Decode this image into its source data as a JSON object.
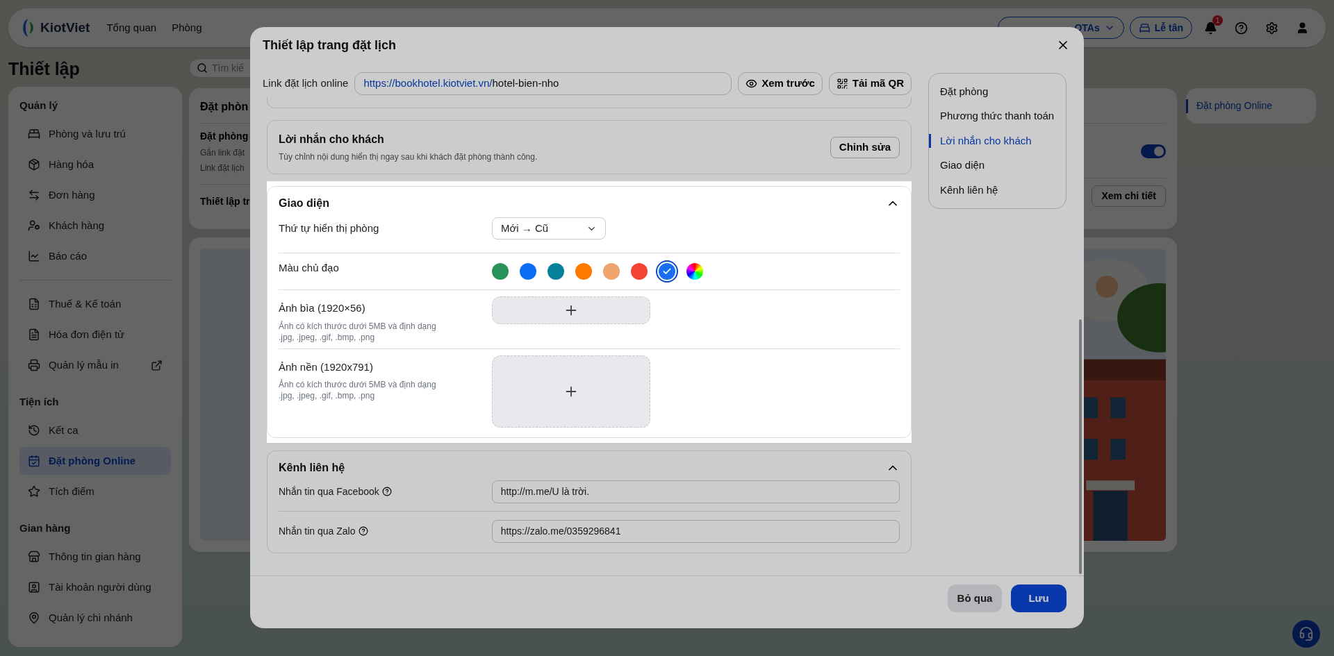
{
  "top_nav": {
    "logo": "KiotViet",
    "items": [
      "Tổng quan",
      "Phòng"
    ],
    "channel_button": "OTAs",
    "reception_button": "Lễ tân",
    "notification_count": "1"
  },
  "page": {
    "title": "Thiết lập",
    "search": {
      "placeholder": "Tìm kiế"
    },
    "sidebar": [
      {
        "title": "Quản lý",
        "items": [
          {
            "label": "Phòng và lưu trú",
            "selected": false,
            "external": false
          },
          {
            "label": "Hàng hóa",
            "selected": false,
            "external": false
          },
          {
            "label": "Đơn hàng",
            "selected": false,
            "external": false
          },
          {
            "label": "Khách hàng",
            "selected": false,
            "external": false
          },
          {
            "label": "Báo cáo",
            "selected": false,
            "external": false
          }
        ]
      },
      {
        "items": [
          {
            "label": "Thuế & Kế toán",
            "selected": false,
            "external": false
          },
          {
            "label": "Hóa đơn điện tử",
            "selected": false,
            "external": false
          },
          {
            "label": "Quản lý mẫu in",
            "selected": false,
            "external": true
          }
        ]
      },
      {
        "title": "Tiện ích",
        "items": [
          {
            "label": "Kết ca",
            "selected": false,
            "external": false
          },
          {
            "label": "Đặt phòng Online",
            "selected": true,
            "external": false
          },
          {
            "label": "Tích điểm",
            "selected": false,
            "external": false
          }
        ]
      },
      {
        "title": "Gian hàng",
        "items": [
          {
            "label": "Thông tin gian hàng",
            "selected": false,
            "external": false
          },
          {
            "label": "Tài khoản người dùng",
            "selected": false,
            "external": false
          },
          {
            "label": "Quản lý chi nhánh",
            "selected": false,
            "external": false
          }
        ]
      }
    ],
    "booking_card": {
      "heading": "Đặt phòn",
      "subheading": "Đặt phòng",
      "lines": [
        "Gắn link đặt",
        "Link đặt lịch"
      ],
      "toggle_on": true,
      "setting_label": "Thiết lập tr",
      "detail_button": "Xem chi tiết"
    },
    "side_panel": [
      {
        "label": "Đặt phòng Online",
        "selected": true
      }
    ]
  },
  "dialog": {
    "title": "Thiết lập trang đặt lịch",
    "link": {
      "label": "Link đặt lịch online",
      "base": "https://bookhotel.kiotviet.vn/",
      "slug": "hotel-bien-nho",
      "preview_button": "Xem trước",
      "qr_button": "Tải mã QR"
    },
    "guest_message": {
      "title": "Lời nhắn cho khách",
      "description": "Tùy chỉnh nội dung hiển thị ngay sau khi khách đặt phòng thành công.",
      "edit_button": "Chỉnh sửa"
    },
    "appearance": {
      "title": "Giao diện",
      "expanded": true,
      "highlighted": true,
      "sort": {
        "label": "Thứ tự hiển thị phòng",
        "value": "Mới → Cũ"
      },
      "color": {
        "label": "Màu chủ đạo",
        "swatches": [
          {
            "kind": "solid",
            "color": "#27935a",
            "selected": false
          },
          {
            "kind": "solid",
            "color": "#0a6cf5",
            "selected": false
          },
          {
            "kind": "solid",
            "color": "#07819a",
            "selected": false
          },
          {
            "kind": "solid",
            "color": "#ff7a00",
            "selected": false
          },
          {
            "kind": "solid",
            "color": "#f0a46e",
            "selected": false
          },
          {
            "kind": "solid",
            "color": "#f44336",
            "selected": false
          },
          {
            "kind": "solid",
            "color": "#1a6ef0",
            "selected": true
          },
          {
            "kind": "spectrum",
            "selected": false
          }
        ]
      },
      "uploads": [
        {
          "kind": "banner",
          "label": "Ảnh bìa (1920×56)",
          "hint": "Ảnh có kích thước dưới 5MB và định dạng .jpg, .jpeg, .gif, .bmp, .png"
        },
        {
          "kind": "background",
          "label": "Ảnh nền (1920x791)",
          "hint": "Ảnh có kích thước dưới 5MB và định dạng .jpg, .jpeg, .gif, .bmp, .png"
        }
      ]
    },
    "contacts": {
      "title": "Kênh liên hệ",
      "expanded": true,
      "fields": [
        {
          "label": "Nhắn tin qua Facebook",
          "value": "http://m.me/U là trời."
        },
        {
          "label": "Nhắn tin qua Zalo",
          "value": "https://zalo.me/0359296841"
        }
      ]
    },
    "section_nav": [
      {
        "label": "Đặt phòng",
        "selected": false
      },
      {
        "label": "Phương thức thanh toán",
        "selected": false
      },
      {
        "label": "Lời nhắn cho khách",
        "selected": true
      },
      {
        "label": "Giao diện",
        "selected": false
      },
      {
        "label": "Kênh liên hệ",
        "selected": false
      }
    ],
    "cancel_button": "Bỏ qua",
    "save_button": "Lưu"
  }
}
